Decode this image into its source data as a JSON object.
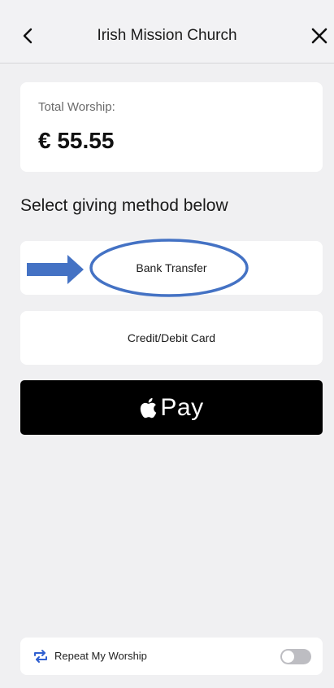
{
  "header": {
    "title": "Irish Mission Church",
    "back_icon": "chevron-left-icon",
    "close_icon": "close-icon"
  },
  "total": {
    "label": "Total Worship:",
    "amount": "€ 55.55"
  },
  "section_title": "Select giving method below",
  "methods": {
    "bank_transfer": "Bank Transfer",
    "card": "Credit/Debit Card",
    "apple_pay": "Pay"
  },
  "annotation": {
    "arrow_color": "#4472c4",
    "highlight_color": "#4472c4"
  },
  "repeat": {
    "label": "Repeat My Worship",
    "enabled": false,
    "icon_color": "#2f5fd0"
  }
}
